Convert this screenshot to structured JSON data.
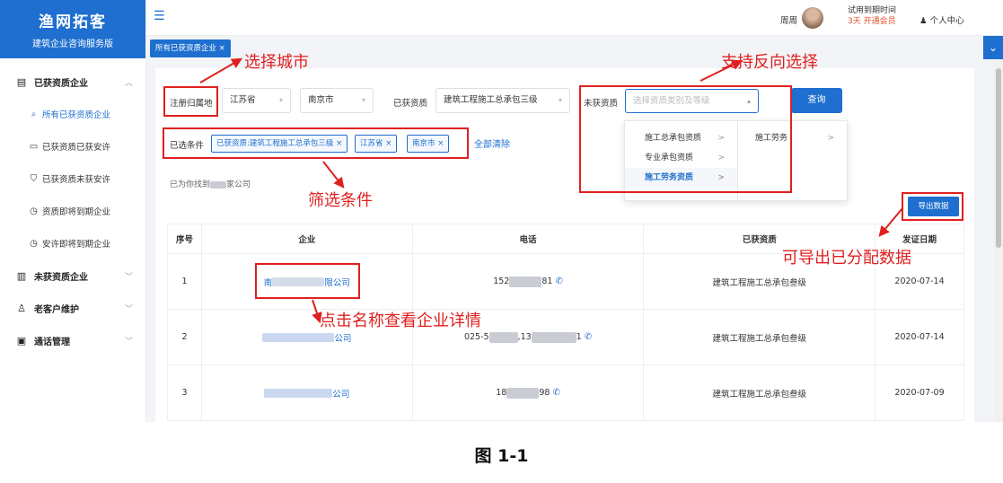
{
  "sidebar": {
    "brand_title": "渔网拓客",
    "brand_subtitle": "建筑企业咨询服务版",
    "groups": [
      {
        "label": "已获资质企业",
        "expanded_chev": "^"
      },
      {
        "label": "未获资质企业",
        "expanded_chev": "v"
      },
      {
        "label": "老客户维护",
        "expanded_chev": "v"
      },
      {
        "label": "通话管理",
        "expanded_chev": "v"
      }
    ],
    "subitems": [
      {
        "label": "所有已获资质企业"
      },
      {
        "label": "已获资质已获安许"
      },
      {
        "label": "已获资质未获安许"
      },
      {
        "label": "资质即将到期企业"
      },
      {
        "label": "安许即将到期企业"
      }
    ]
  },
  "topbar": {
    "user_name": "周周",
    "trial_label": "试用到期时间",
    "trial_days": "3天",
    "trial_action": "开通会员",
    "personal_center": "个人中心"
  },
  "tabs": [
    {
      "label": "所有已获资质企业 ×"
    }
  ],
  "filters": {
    "region_label": "注册归属地",
    "province": "江苏省",
    "city": "南京市",
    "obtained_label": "已获资质",
    "obtained_value": "建筑工程施工总承包三级",
    "missing_label": "未获资质",
    "missing_placeholder": "选择资质类别及等级",
    "query_button": "查询",
    "selected_label": "已选条件",
    "chips": [
      "已获资质:建筑工程施工总承包三级 ×",
      "江苏省 ×",
      "南京市 ×"
    ],
    "clear_all": "全部清除",
    "found_prefix": "已为你找到",
    "found_suffix": "家公司"
  },
  "dropdown": {
    "col1": [
      "施工总承包资质",
      "专业承包资质",
      "施工劳务资质"
    ],
    "col2": [
      "施工劳务"
    ],
    "active": "施工劳务资质"
  },
  "export_button": "导出数据",
  "table": {
    "headers": [
      "序号",
      "企业",
      "电话",
      "已获资质",
      "发证日期"
    ],
    "rows": [
      {
        "index": "1",
        "company_a": "南",
        "company_b": "限公司",
        "phone_a": "152",
        "phone_b": "81",
        "qualification": "建筑工程施工总承包叁级",
        "date": "2020-07-14"
      },
      {
        "index": "2",
        "company_a": "",
        "company_b": "公司",
        "phone_a": "025-5",
        "phone_b": ",13",
        "phone_c": "1",
        "qualification": "建筑工程施工总承包叁级",
        "date": "2020-07-14"
      },
      {
        "index": "3",
        "company_a": "",
        "company_b": "公司",
        "phone_a": "18",
        "phone_b": "98",
        "qualification": "建筑工程施工总承包叁级",
        "date": "2020-07-09"
      }
    ]
  },
  "annotations": {
    "city": "选择城市",
    "reverse": "支持反向选择",
    "filter": "筛选条件",
    "export": "可导出已分配数据",
    "detail": "点击名称查看企业详情"
  },
  "caption": "图 1-1",
  "colors": {
    "primary": "#1e6fcf",
    "annotation": "#e02020",
    "trial": "#e0502a"
  }
}
